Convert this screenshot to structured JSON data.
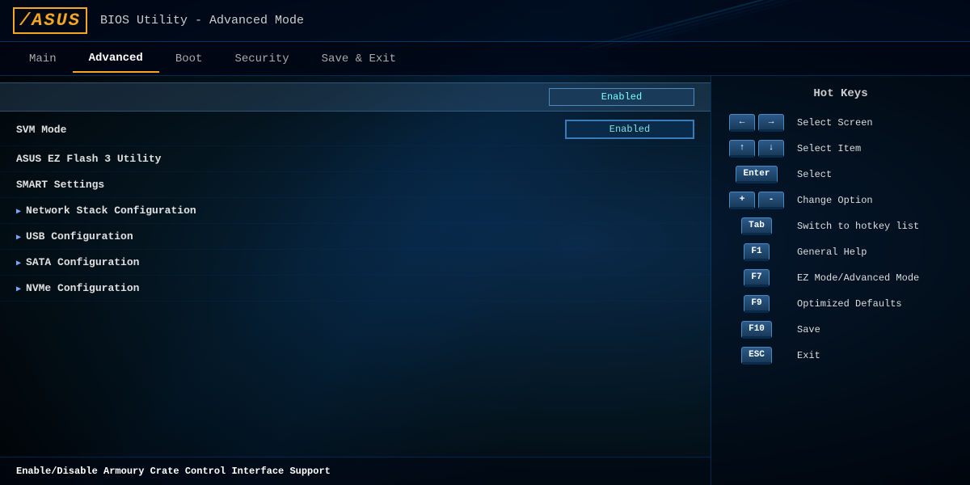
{
  "header": {
    "logo": "/ASUS",
    "title": "BIOS Utility - Advanced Mode"
  },
  "nav": {
    "items": [
      {
        "id": "main",
        "label": "Main",
        "active": false
      },
      {
        "id": "advanced",
        "label": "Advanced",
        "active": true
      },
      {
        "id": "boot",
        "label": "Boot",
        "active": false
      },
      {
        "id": "security",
        "label": "Security",
        "active": false
      },
      {
        "id": "save-exit",
        "label": "Save & Exit",
        "active": false
      }
    ]
  },
  "settings": {
    "highlighted_label": "",
    "highlighted_value": "Enabled",
    "rows": [
      {
        "id": "svm-mode",
        "label": "SVM Mode",
        "value": "Enabled",
        "type": "value"
      },
      {
        "id": "ez-flash",
        "label": "ASUS EZ Flash 3 Utility",
        "value": "",
        "type": "link"
      },
      {
        "id": "smart-settings",
        "label": "SMART Settings",
        "value": "",
        "type": "link"
      },
      {
        "id": "network-stack",
        "label": "Network Stack Configuration",
        "value": "",
        "type": "arrow"
      },
      {
        "id": "usb-config",
        "label": "USB Configuration",
        "value": "",
        "type": "arrow"
      },
      {
        "id": "sata-config",
        "label": "SATA Configuration",
        "value": "",
        "type": "arrow"
      },
      {
        "id": "nvme-config",
        "label": "NVMe Configuration",
        "value": "",
        "type": "arrow"
      }
    ]
  },
  "footer": {
    "description": "Enable/Disable Armoury Crate Control Interface Support"
  },
  "hotkeys": {
    "title": "Hot Keys",
    "items": [
      {
        "keys": [
          "←",
          "→"
        ],
        "description": "Select Screen"
      },
      {
        "keys": [
          "↑",
          "↓"
        ],
        "description": "Select Item"
      },
      {
        "keys": [
          "Enter"
        ],
        "description": "Select"
      },
      {
        "keys": [
          "+",
          "-"
        ],
        "description": "Change Option"
      },
      {
        "keys": [
          "Tab"
        ],
        "description": "Switch to hotkey list"
      },
      {
        "keys": [
          "F1"
        ],
        "description": "General Help"
      },
      {
        "keys": [
          "F7"
        ],
        "description": "EZ Mode/Advanced Mode"
      },
      {
        "keys": [
          "F9"
        ],
        "description": "Optimized Defaults"
      },
      {
        "keys": [
          "F10"
        ],
        "description": "Save"
      },
      {
        "keys": [
          "ESC"
        ],
        "description": "Exit"
      }
    ]
  }
}
